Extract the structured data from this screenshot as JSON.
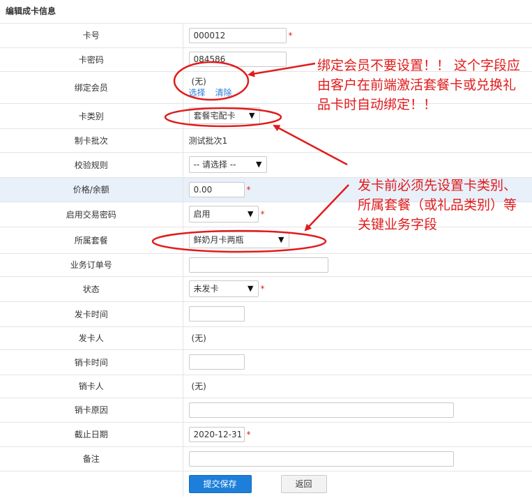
{
  "header": {
    "title": "编辑成卡信息"
  },
  "fields": {
    "card_no": {
      "label": "卡号",
      "value": "000012",
      "required": "*"
    },
    "card_pwd": {
      "label": "卡密码",
      "value": "084586"
    },
    "member": {
      "label": "绑定会员",
      "value": "(无)",
      "select_link": "选择",
      "clear_link": "清除"
    },
    "card_type": {
      "label": "卡类别",
      "value": "套餐宅配卡"
    },
    "batch": {
      "label": "制卡批次",
      "value": "测试批次1"
    },
    "rule": {
      "label": "校验规则",
      "value": "-- 请选择 --"
    },
    "price": {
      "label": "价格/余额",
      "value": "0.00",
      "required": "*"
    },
    "trade_pwd": {
      "label": "启用交易密码",
      "value": "启用",
      "required": "*"
    },
    "package": {
      "label": "所属套餐",
      "value": "鲜奶月卡两瓶"
    },
    "order_no": {
      "label": "业务订单号",
      "value": ""
    },
    "status": {
      "label": "状态",
      "value": "未发卡",
      "required": "*"
    },
    "issue_time": {
      "label": "发卡时间",
      "value": ""
    },
    "issuer": {
      "label": "发卡人",
      "value": "(无)"
    },
    "cancel_time": {
      "label": "销卡时间",
      "value": ""
    },
    "canceller": {
      "label": "销卡人",
      "value": "(无)"
    },
    "cancel_reason": {
      "label": "销卡原因",
      "value": ""
    },
    "deadline": {
      "label": "截止日期",
      "value": "2020-12-31",
      "required": "*"
    },
    "remark": {
      "label": "备注",
      "value": ""
    }
  },
  "buttons": {
    "submit": "提交保存",
    "back": "返回"
  },
  "annotations": {
    "note1": "绑定会员不要设置！！ 这个字段应由客户在前端激活套餐卡或兑换礼品卡时自动绑定！！",
    "note2": "发卡前必须先设置卡类别、所属套餐（或礼品类别）等关键业务字段"
  },
  "colors": {
    "accent": "#1d7fd9",
    "annotation": "#e11b1b",
    "highlight_row": "#e8f0fa",
    "required": "#e02020"
  },
  "icons": {
    "dropdown": "triangle-down-icon"
  }
}
